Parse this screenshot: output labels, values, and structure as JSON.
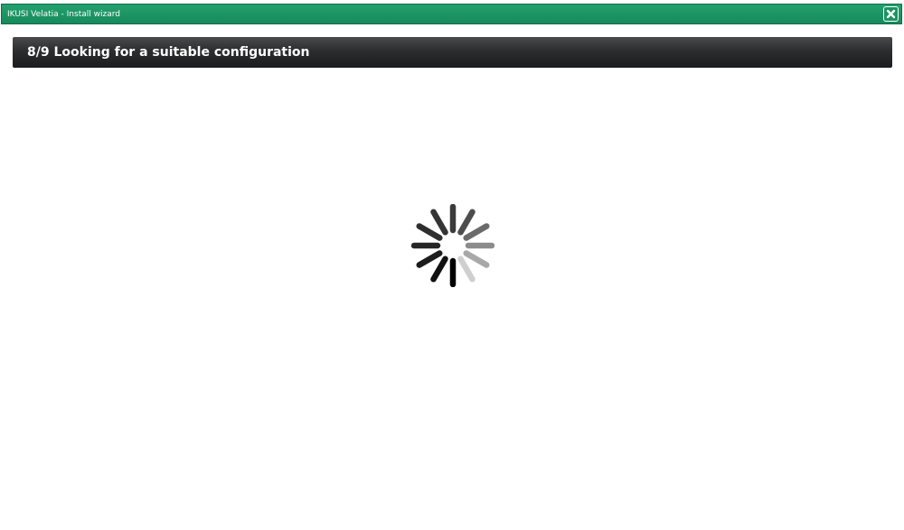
{
  "window": {
    "title": "IKUSI Velatia - Install wizard",
    "close_icon": "close-icon"
  },
  "step": {
    "title": "8/9 Looking for a suitable configuration"
  },
  "loading": {
    "icon": "loading-spinner-icon"
  },
  "colors": {
    "titlebar": "#1b9463",
    "header": "#2c2d2f",
    "background": "#ffffff"
  }
}
